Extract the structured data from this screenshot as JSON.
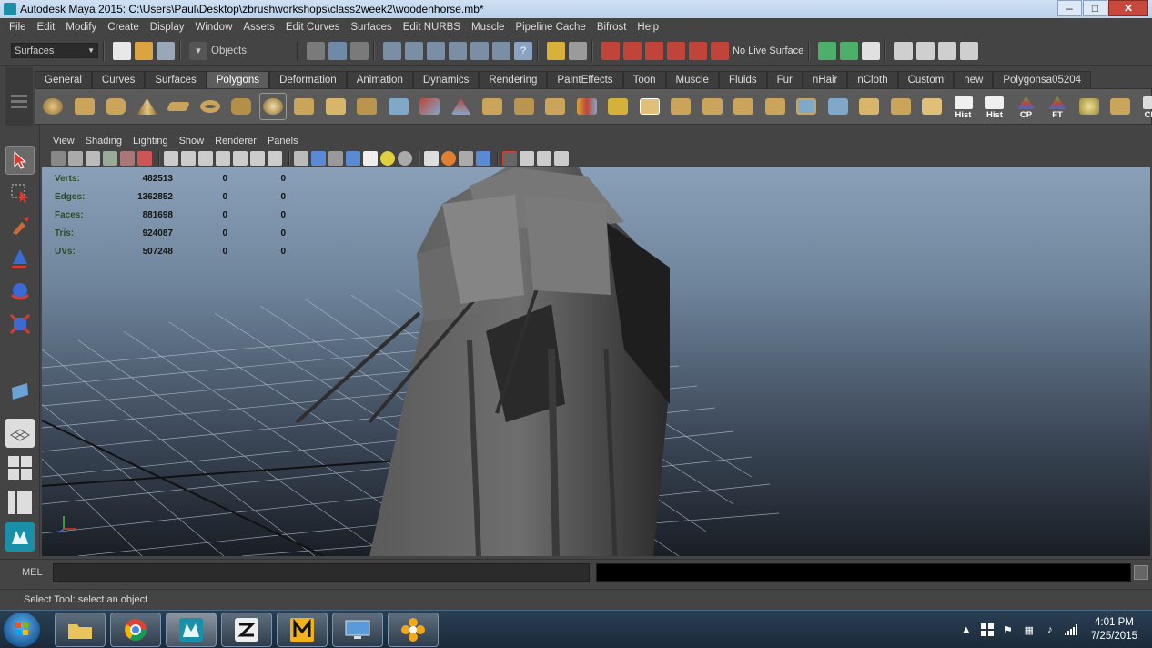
{
  "window": {
    "title": "Autodesk Maya 2015: C:\\Users\\Paul\\Desktop\\zbrushworkshops\\class2week2\\woodenhorse.mb*",
    "min_glyph": "–",
    "max_glyph": "□",
    "close_glyph": "✕"
  },
  "menubar": {
    "items": [
      "File",
      "Edit",
      "Modify",
      "Create",
      "Display",
      "Window",
      "Assets",
      "Edit Curves",
      "Surfaces",
      "Edit NURBS",
      "Muscle",
      "Pipeline Cache",
      "Bifrost",
      "Help"
    ]
  },
  "statusline": {
    "mode": "Surfaces",
    "selection_label": "Objects",
    "live_surface": "No Live Surface"
  },
  "shelf": {
    "tabs": [
      "General",
      "Curves",
      "Surfaces",
      "Polygons",
      "Deformation",
      "Animation",
      "Dynamics",
      "Rendering",
      "PaintEffects",
      "Toon",
      "Muscle",
      "Fluids",
      "Fur",
      "nHair",
      "nCloth",
      "Custom",
      "new",
      "Polygonsa05204"
    ],
    "active_tab": "Polygons",
    "labeled_buttons": [
      "Hist",
      "Hist",
      "CP",
      "FT",
      "CPI"
    ]
  },
  "panel": {
    "menus": [
      "View",
      "Shading",
      "Lighting",
      "Show",
      "Renderer",
      "Panels"
    ]
  },
  "hud": {
    "rows": [
      {
        "label": "Verts:",
        "v1": "482513",
        "v2": "0",
        "v3": "0"
      },
      {
        "label": "Edges:",
        "v1": "1362852",
        "v2": "0",
        "v3": "0"
      },
      {
        "label": "Faces:",
        "v1": "881698",
        "v2": "0",
        "v3": "0"
      },
      {
        "label": "Tris:",
        "v1": "924087",
        "v2": "0",
        "v3": "0"
      },
      {
        "label": "UVs:",
        "v1": "507248",
        "v2": "0",
        "v3": "0"
      }
    ]
  },
  "commandline": {
    "label": "MEL"
  },
  "helpline": {
    "text": "Select Tool: select an object"
  },
  "taskbar": {
    "time": "4:01 PM",
    "date": "7/25/2015"
  },
  "colors": {
    "maya_bg": "#444444",
    "viewport_top": "#8aa0b8",
    "viewport_bottom": "#1a1e25",
    "titlebar": "#b9d1ea"
  }
}
